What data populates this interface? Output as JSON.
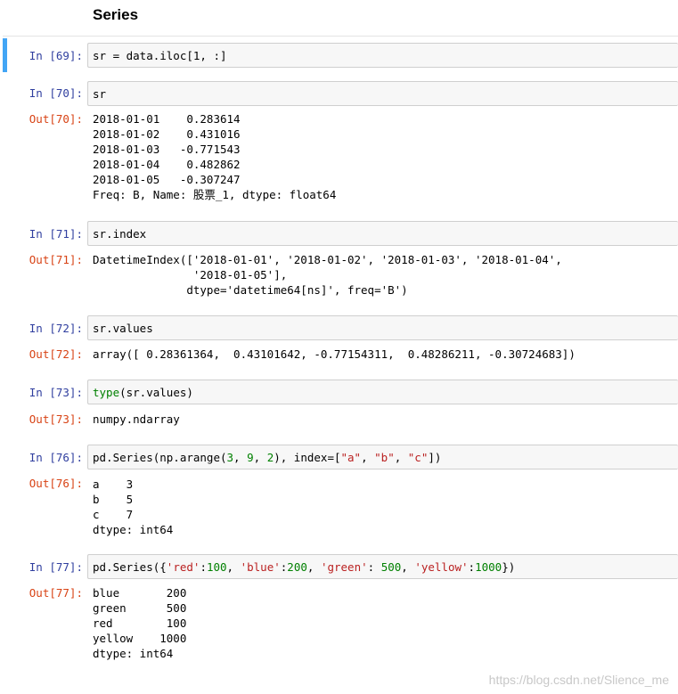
{
  "heading": "Series",
  "cells": [
    {
      "in_prompt": "In  [69]:",
      "code": "sr = data.iloc[1, :]"
    },
    {
      "in_prompt": "In  [70]:",
      "code": "sr",
      "out_prompt": "Out[70]:",
      "output": "2018-01-01    0.283614\n2018-01-02    0.431016\n2018-01-03   -0.771543\n2018-01-04    0.482862\n2018-01-05   -0.307247\nFreq: B, Name: 股票_1, dtype: float64"
    },
    {
      "in_prompt": "In  [71]:",
      "code": "sr.index",
      "out_prompt": "Out[71]:",
      "output": "DatetimeIndex(['2018-01-01', '2018-01-02', '2018-01-03', '2018-01-04',\n               '2018-01-05'],\n              dtype='datetime64[ns]', freq='B')"
    },
    {
      "in_prompt": "In  [72]:",
      "code": "sr.values",
      "out_prompt": "Out[72]:",
      "output": "array([ 0.28361364,  0.43101642, -0.77154311,  0.48286211, -0.30724683])"
    },
    {
      "in_prompt": "In  [73]:",
      "code": "type(sr.values)",
      "out_prompt": "Out[73]:",
      "output": "numpy.ndarray"
    },
    {
      "in_prompt": "In  [76]:",
      "code": "pd.Series(np.arange(3, 9, 2), index=[\"a\", \"b\", \"c\"])",
      "out_prompt": "Out[76]:",
      "output": "a    3\nb    5\nc    7\ndtype: int64"
    },
    {
      "in_prompt": "In  [77]:",
      "code": "pd.Series({'red':100, 'blue':200, 'green': 500, 'yellow':1000})",
      "out_prompt": "Out[77]:",
      "output": "blue       200\ngreen      500\nred        100\nyellow    1000\ndtype: int64"
    }
  ],
  "watermark": "https://blog.csdn.net/Slience_me"
}
